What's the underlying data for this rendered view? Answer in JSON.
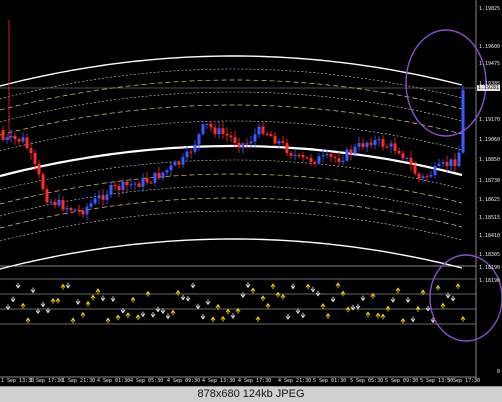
{
  "chart": {
    "price_labels": [
      "1.19825",
      "1.19600",
      "1.19475",
      "1.19385",
      "1.19170",
      "1.19060",
      "1.18850",
      "1.18730",
      "1.18625",
      "1.18515",
      "1.18410",
      "1.18305"
    ],
    "current_price": "1.19281",
    "indicator_labels": [
      "1.18190",
      "1.18190",
      "0"
    ],
    "time_labels": [
      "1 Sep 13:30",
      "1 Sep 17:30",
      "1 Sep 21:30",
      "4 Sep 01:30",
      "4 Sep 05:30",
      "4 Sep 09:30",
      "4 Sep 13:30",
      "4 Sep 17:30",
      "4 Sep 21:30",
      "5 Sep 01:30",
      "5 Sep 05:30",
      "5 Sep 09:30",
      "5 Sep 13:30",
      "5 Sep 17:30"
    ],
    "colors": {
      "background": "#000000",
      "bull_candle": "#3a5bff",
      "bear_candle": "#ff2a2a",
      "envelope_outer": "#ffffff",
      "envelope_dashed": "#e6c76a",
      "envelope_dotted": "#d8d8d8",
      "arrow_up": "#ffd700",
      "arrow_down": "#e0e0e0",
      "highlight_circle": "#8a4fc9"
    }
  },
  "status_bar": {
    "text": "878x680  124kb  JPEG"
  }
}
